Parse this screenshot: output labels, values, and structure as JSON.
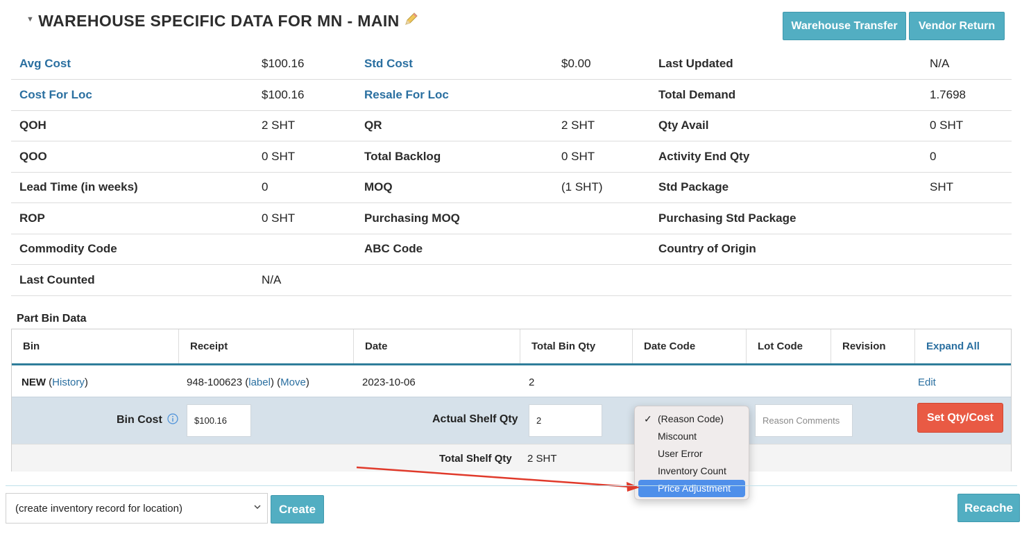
{
  "header": {
    "title": "WAREHOUSE SPECIFIC DATA FOR MN - MAIN",
    "warehouse_transfer": "Warehouse Transfer",
    "vendor_return": "Vendor Return"
  },
  "info_rows": [
    [
      {
        "label": "Avg Cost",
        "value": "$100.16",
        "link": true
      },
      {
        "label": "Std Cost",
        "value": "$0.00",
        "link": true
      },
      {
        "label": "Last Updated",
        "value": "N/A",
        "link": false
      }
    ],
    [
      {
        "label": "Cost For Loc",
        "value": "$100.16",
        "link": true
      },
      {
        "label": "Resale For Loc",
        "value": "",
        "link": true
      },
      {
        "label": "Total Demand",
        "value": "1.7698",
        "link": false
      }
    ],
    [
      {
        "label": "QOH",
        "value": "2 SHT",
        "link": false
      },
      {
        "label": "QR",
        "value": "2 SHT",
        "link": false
      },
      {
        "label": "Qty Avail",
        "value": "0 SHT",
        "link": false
      }
    ],
    [
      {
        "label": "QOO",
        "value": "0 SHT",
        "link": false
      },
      {
        "label": "Total Backlog",
        "value": "0 SHT",
        "link": false
      },
      {
        "label": "Activity End Qty",
        "value": "0",
        "link": false
      }
    ],
    [
      {
        "label": "Lead Time (in weeks)",
        "value": "0",
        "link": false
      },
      {
        "label": "MOQ",
        "value": "(1 SHT)",
        "link": false
      },
      {
        "label": "Std Package",
        "value": "SHT",
        "link": false
      }
    ],
    [
      {
        "label": "ROP",
        "value": "0 SHT",
        "link": false
      },
      {
        "label": "Purchasing MOQ",
        "value": "",
        "link": false
      },
      {
        "label": "Purchasing Std Package",
        "value": "",
        "link": false
      }
    ],
    [
      {
        "label": "Commodity Code",
        "value": "",
        "link": false
      },
      {
        "label": "ABC Code",
        "value": "",
        "link": false
      },
      {
        "label": "Country of Origin",
        "value": "",
        "link": false
      }
    ],
    [
      {
        "label": "Last Counted",
        "value": "N/A",
        "link": false
      }
    ]
  ],
  "part_bin": {
    "section_title": "Part Bin Data",
    "columns": [
      "Bin",
      "Receipt",
      "Date",
      "Total Bin Qty",
      "Date Code",
      "Lot Code",
      "Revision",
      "Expand All"
    ],
    "row": {
      "bin": "NEW",
      "history": "History",
      "receipt": "948-100623",
      "label_link": "label",
      "move_link": "Move",
      "date": "2023-10-06",
      "total_bin_qty": "2",
      "edit": "Edit"
    },
    "edit": {
      "bin_cost_label": "Bin Cost",
      "bin_cost_value": "$100.16",
      "actual_shelf_label": "Actual Shelf Qty",
      "actual_shelf_value": "2",
      "reason_comments_placeholder": "Reason Comments",
      "set_button": "Set Qty/Cost"
    },
    "total_label": "Total Shelf Qty",
    "total_value": "2 SHT"
  },
  "reason_dropdown": {
    "options": [
      "(Reason Code)",
      "Miscount",
      "User Error",
      "Inventory Count",
      "Price Adjustment"
    ],
    "checked": "(Reason Code)",
    "highlighted": "Price Adjustment"
  },
  "footer": {
    "location_select": "(create inventory record for location)",
    "create": "Create",
    "recache": "Recache"
  },
  "colors": {
    "teal": "#52aec2",
    "link": "#2a6fa0",
    "red": "#e95a44",
    "highlight": "#4f8fea",
    "arrow": "#e03a2b"
  }
}
